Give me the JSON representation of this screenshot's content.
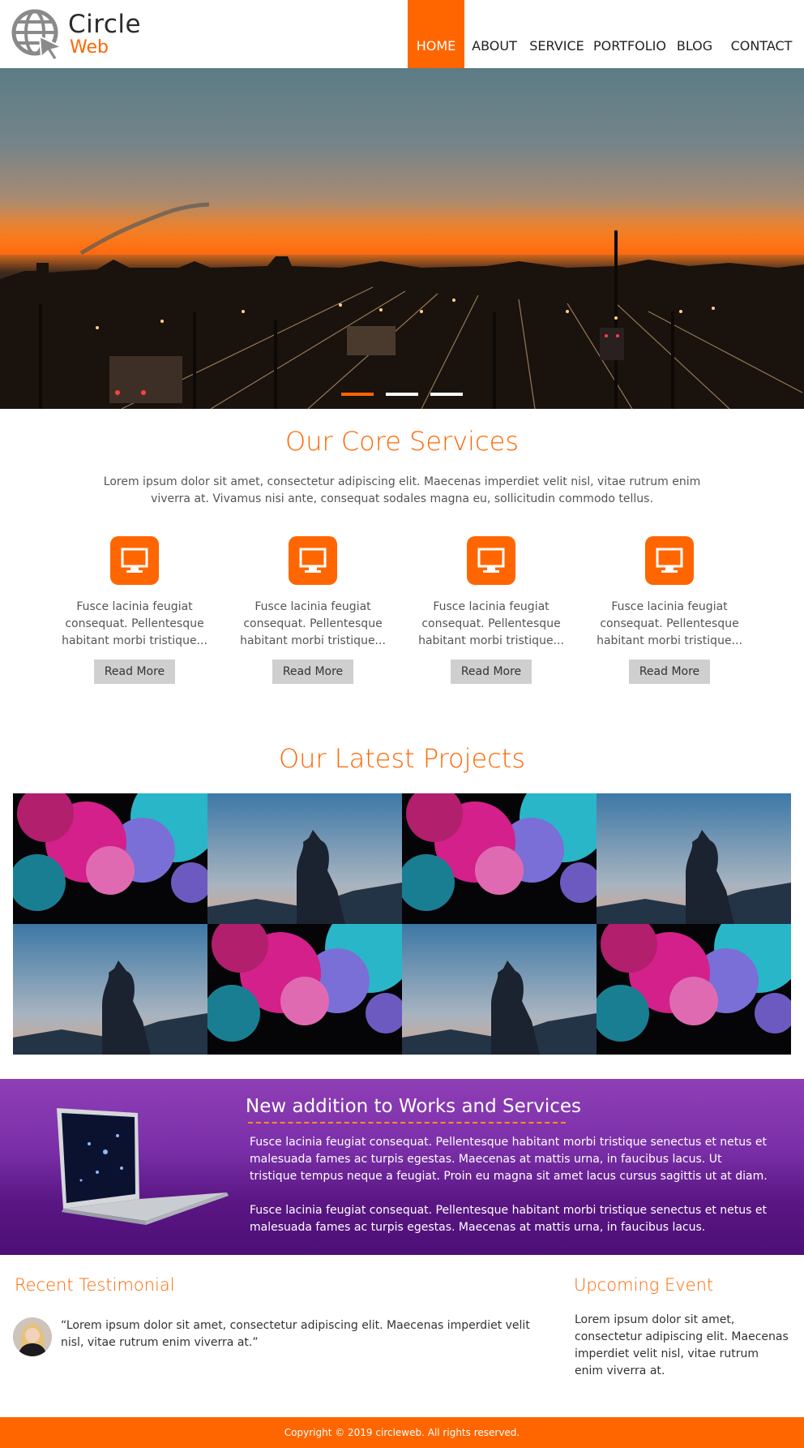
{
  "brand": {
    "title": "Circle",
    "subtitle": "Web",
    "logo_icon": "globe-cursor-icon",
    "accent": "#ff6600"
  },
  "nav": {
    "items": [
      {
        "label": "HOME",
        "active": true
      },
      {
        "label": "ABOUT",
        "active": false
      },
      {
        "label": "SERVICE",
        "active": false
      },
      {
        "label": "PORTFOLIO",
        "active": false
      },
      {
        "label": "BLOG",
        "active": false
      },
      {
        "label": "CONTACT",
        "active": false
      }
    ]
  },
  "hero": {
    "slides": 3,
    "active_slide": 1
  },
  "services": {
    "title": "Our Core Services",
    "lead": "Lorem ipsum dolor sit amet, consectetur adipiscing elit. Maecenas imperdiet velit nisl, vitae rutrum enim viverra at. Vivamus nisi ante, consequat sodales magna eu, sollicitudin commodo tellus.",
    "items": [
      {
        "icon": "monitor-icon",
        "text": "Fusce lacinia feugiat consequat. Pellentesque habitant morbi tristique...",
        "button": "Read More"
      },
      {
        "icon": "monitor-icon",
        "text": "Fusce lacinia feugiat consequat. Pellentesque habitant morbi tristique...",
        "button": "Read More"
      },
      {
        "icon": "monitor-icon",
        "text": "Fusce lacinia feugiat consequat. Pellentesque habitant morbi tristique...",
        "button": "Read More"
      },
      {
        "icon": "monitor-icon",
        "text": "Fusce lacinia feugiat consequat. Pellentesque habitant morbi tristique...",
        "button": "Read More"
      }
    ]
  },
  "projects": {
    "title": "Our Latest Projects",
    "tiles": [
      "ink-smoke",
      "statue-sky",
      "ink-smoke",
      "statue-sky",
      "statue-sky",
      "ink-smoke",
      "statue-sky",
      "ink-smoke"
    ]
  },
  "promo": {
    "title": "New addition to Works and Services",
    "paragraph_1": "Fusce lacinia feugiat consequat. Pellentesque habitant morbi tristique senectus et netus et malesuada fames ac turpis egestas. Maecenas at mattis urna, in faucibus lacus. Ut tristique tempus neque a feugiat. Proin eu magna sit amet lacus cursus sagittis ut at diam.",
    "paragraph_2": "Fusce lacinia feugiat consequat. Pellentesque habitant morbi tristique senectus et netus et malesuada fames ac turpis egestas. Maecenas at mattis urna, in faucibus lacus."
  },
  "testimonial": {
    "title": "Recent Testimonial",
    "quote": "“Lorem ipsum dolor sit amet, consectetur adipiscing elit. Maecenas imperdiet velit nisl, vitae rutrum enim viverra at.”"
  },
  "event": {
    "title": "Upcoming Event",
    "text": "Lorem ipsum dolor sit amet, consectetur adipiscing elit. Maecenas imperdiet velit nisl, vitae rutrum enim viverra at."
  },
  "footer": {
    "copyright": "Copyright © 2019 circleweb. All rights reserved."
  }
}
